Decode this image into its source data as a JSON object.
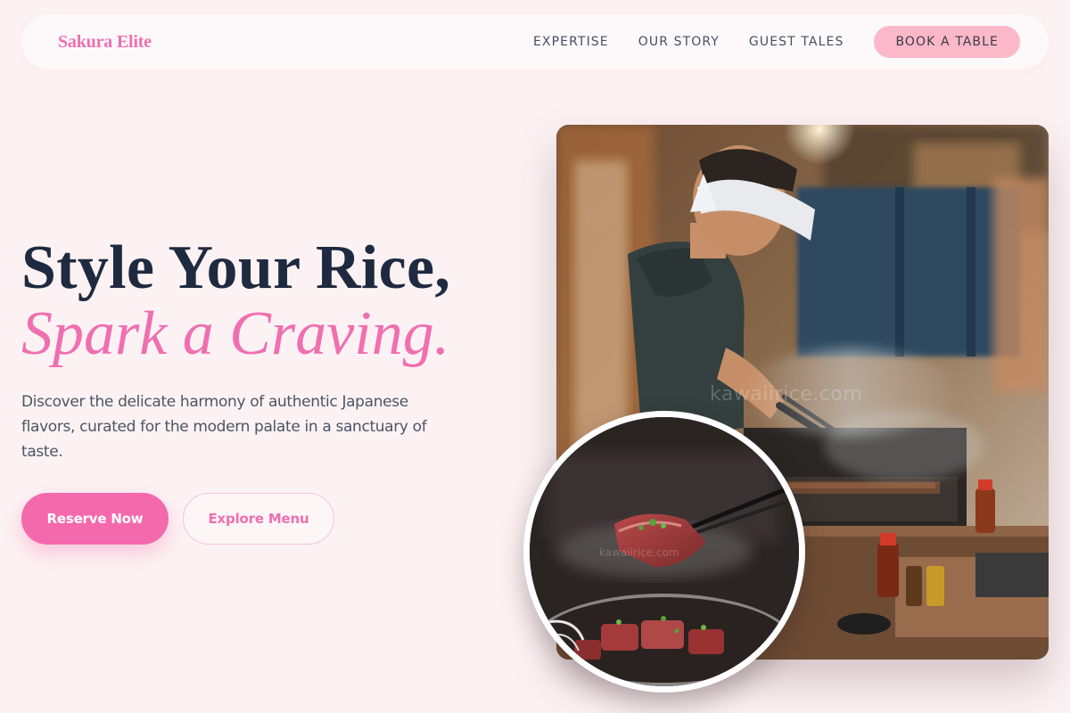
{
  "brand": {
    "name": "Sakura Elite"
  },
  "nav": {
    "links": [
      "EXPERTISE",
      "OUR STORY",
      "GUEST TALES"
    ],
    "cta_label": "BOOK A TABLE"
  },
  "hero": {
    "title_line1": "Style Your Rice,",
    "title_line2": "Spark a Craving.",
    "description": "Discover the delicate harmony of authentic Japanese flavors, curated for the modern palate in a sanctuary of taste.",
    "primary_button": "Reserve Now",
    "secondary_button": "Explore Menu"
  },
  "images": {
    "main_watermark": "kawaiirice.com",
    "circle_watermark": "kawaiirice.com"
  },
  "colors": {
    "background": "#fdf2f3",
    "accent_pink": "#f06fb0",
    "button_pink": "#f469ac",
    "book_button": "#fbb8c9",
    "heading": "#1e2a40"
  }
}
